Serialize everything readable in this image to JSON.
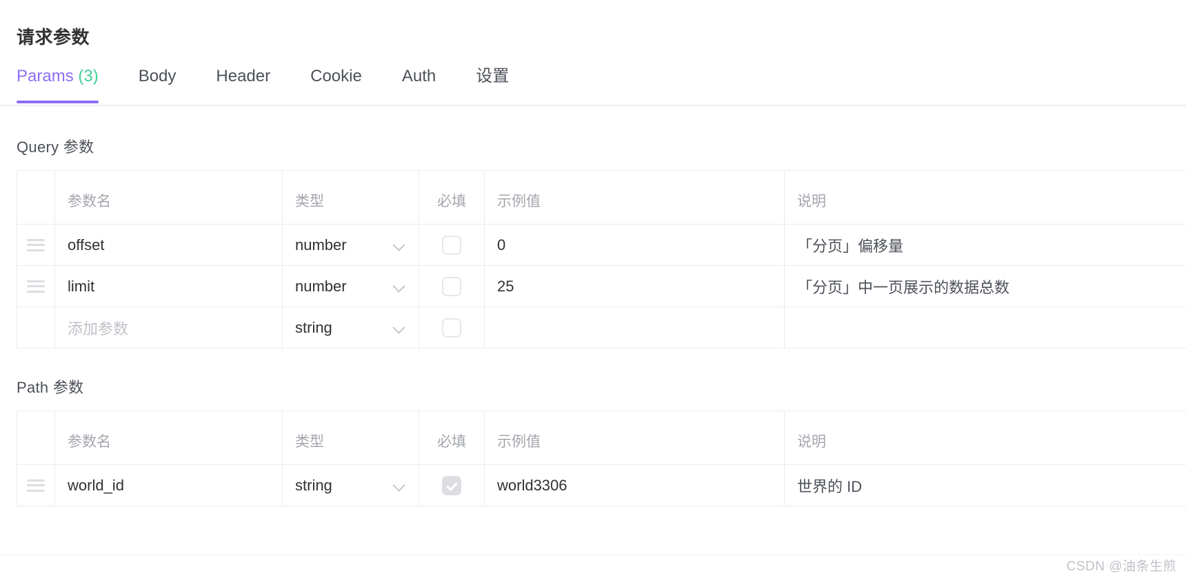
{
  "panel": {
    "title": "请求参数"
  },
  "tabs": [
    {
      "label": "Params",
      "count": "(3)",
      "active": true
    },
    {
      "label": "Body",
      "count": "",
      "active": false
    },
    {
      "label": "Header",
      "count": "",
      "active": false
    },
    {
      "label": "Cookie",
      "count": "",
      "active": false
    },
    {
      "label": "Auth",
      "count": "",
      "active": false
    },
    {
      "label": "设置",
      "count": "",
      "active": false
    }
  ],
  "colors": {
    "accent": "#8a6ef3",
    "count_green": "#3ecf94",
    "border": "#ebebed",
    "placeholder": "#c0c2c8",
    "header_text": "#a3a6ad"
  },
  "sections": {
    "query": {
      "label": "Query 参数",
      "columns": [
        "",
        "参数名",
        "类型",
        "必填",
        "示例值",
        "说明"
      ],
      "rows": [
        {
          "drag": true,
          "name": "offset",
          "name_is_placeholder": false,
          "type": "number",
          "required": false,
          "required_disabled": false,
          "example": "0",
          "description": "「分页」偏移量"
        },
        {
          "drag": true,
          "name": "limit",
          "name_is_placeholder": false,
          "type": "number",
          "required": false,
          "required_disabled": false,
          "example": "25",
          "description": "「分页」中一页展示的数据总数"
        },
        {
          "drag": false,
          "name": "添加参数",
          "name_is_placeholder": true,
          "type": "string",
          "required": false,
          "required_disabled": false,
          "example": "",
          "description": ""
        }
      ]
    },
    "path": {
      "label": "Path 参数",
      "columns": [
        "",
        "参数名",
        "类型",
        "必填",
        "示例值",
        "说明"
      ],
      "rows": [
        {
          "drag": true,
          "name": "world_id",
          "name_is_placeholder": false,
          "type": "string",
          "required": true,
          "required_disabled": true,
          "example": "world3306",
          "description": "世界的 ID"
        }
      ]
    }
  },
  "watermark": {
    "text": "CSDN @油条生煎"
  }
}
